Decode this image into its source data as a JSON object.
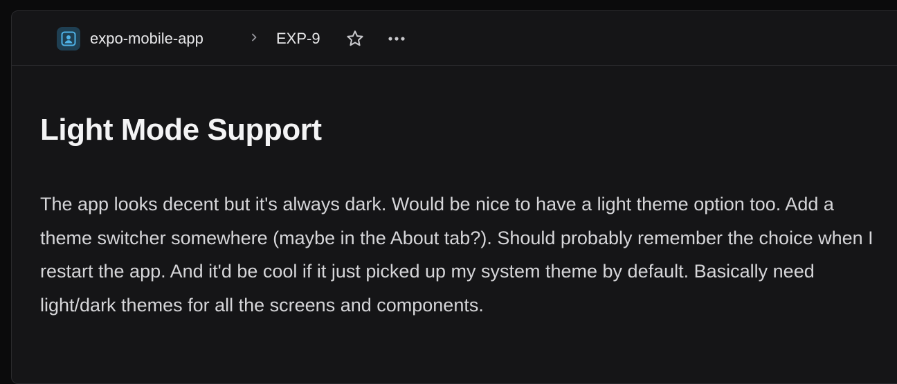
{
  "breadcrumb": {
    "project_name": "expo-mobile-app",
    "issue_id": "EXP-9",
    "separator_icon": "chevron-right-icon"
  },
  "actions": {
    "favorite_icon": "star-outline-icon",
    "more_icon": "ellipsis-horizontal-icon"
  },
  "issue": {
    "title": "Light Mode Support",
    "description": "The app looks decent but it's always dark. Would be nice to have a light theme option too. Add a theme switcher somewhere (maybe in the About tab?). Should probably remember the choice when I restart the app. And it'd be cool if it just picked up my system theme by default. Basically need light/dark themes for all the screens and components."
  },
  "colors": {
    "background": "#151517",
    "project_badge": "#1f3f52",
    "project_badge_accent": "#4fb3e8",
    "text_primary": "#f4f4f5",
    "text_secondary": "#d6d6d9"
  }
}
